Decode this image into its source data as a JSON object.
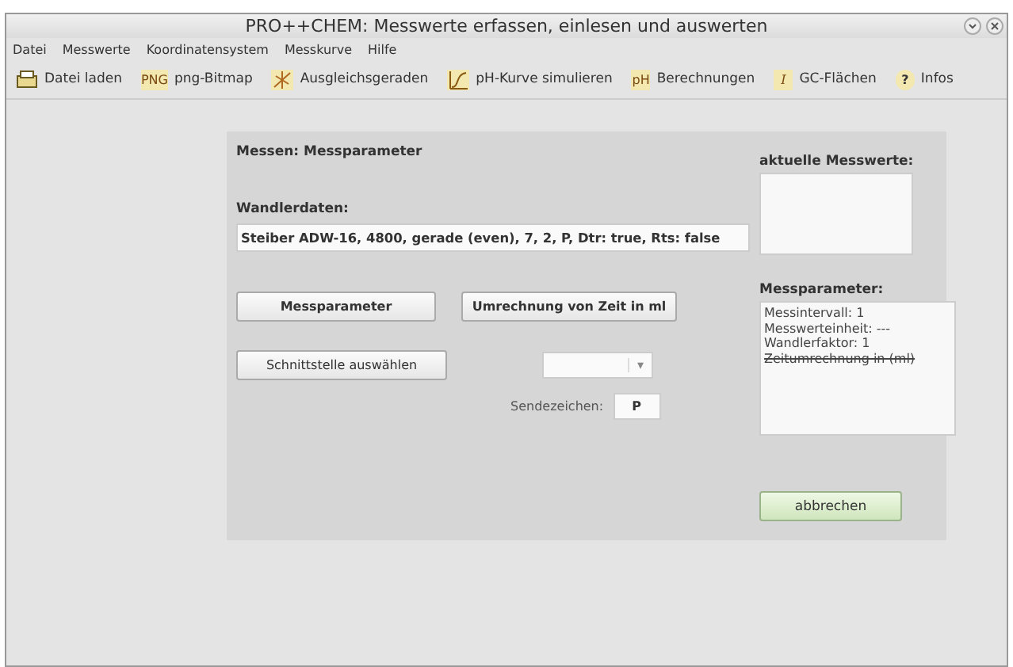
{
  "window": {
    "title": "PRO++CHEM: Messwerte erfassen, einlesen und auswerten"
  },
  "menu": [
    "Datei",
    "Messwerte",
    "Koordinatensystem",
    "Messkurve",
    "Hilfe"
  ],
  "toolbar": [
    {
      "label": "Datei laden",
      "kind": "printer"
    },
    {
      "label": "png-Bitmap",
      "kind": "png",
      "glyph": "PNG"
    },
    {
      "label": "Ausgleichsgeraden",
      "kind": "lines"
    },
    {
      "label": "pH-Kurve simulieren",
      "kind": "curve"
    },
    {
      "label": "Berechnungen",
      "kind": "ph",
      "glyph": "pH"
    },
    {
      "label": "GC-Flächen",
      "kind": "integral",
      "glyph": "I"
    },
    {
      "label": "Infos",
      "kind": "help",
      "glyph": "?"
    }
  ],
  "panel": {
    "title": "Messen: Messparameter",
    "converter_label": "Wandlerdaten:",
    "converter_value": "Steiber ADW-16, 4800, gerade (even), 7, 2, P, Dtr: true, Rts: false",
    "buttons": [
      "Messparameter",
      "Umrechnung von Zeit in ml"
    ],
    "interface_button": "Schnittstelle auswählen",
    "dropdown_arrow": "▾",
    "send_label": "Sendezeichen:",
    "send_value": "P",
    "current_label": "aktuelle Messwerte:",
    "params_label": "Messparameter:",
    "params": [
      {
        "text": "Messintervall: 1",
        "struck": false
      },
      {
        "text": "Messwerteinheit: ---",
        "struck": false
      },
      {
        "text": "Wandlerfaktor: 1",
        "struck": false
      },
      {
        "text": "Zeitumrechnung in (ml)",
        "struck": true
      }
    ],
    "cancel": "abbrechen"
  }
}
